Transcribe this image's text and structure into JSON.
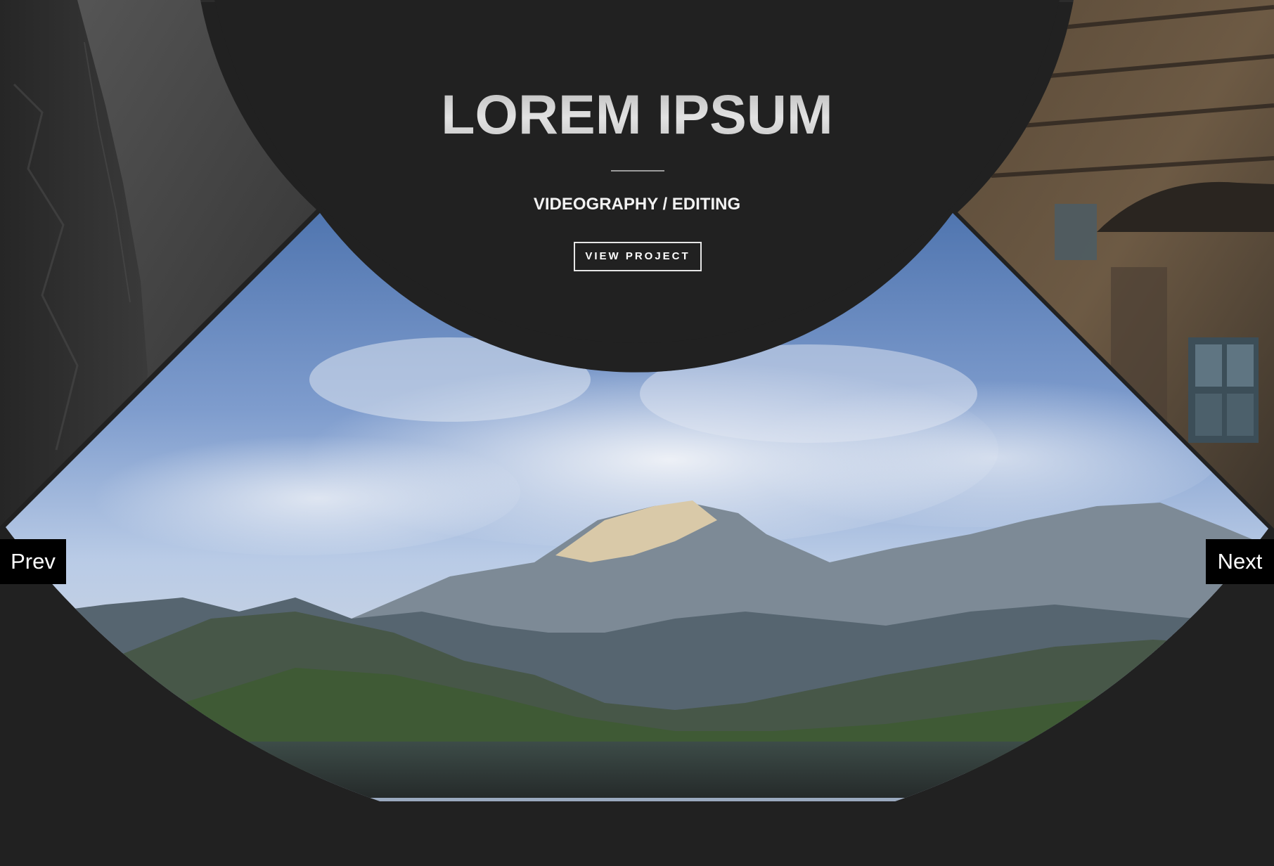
{
  "slide": {
    "title": "LOREM IPSUM",
    "subtitle": "VIDEOGRAPHY / EDITING",
    "button_label": "VIEW PROJECT"
  },
  "navigation": {
    "prev_label": "Prev",
    "next_label": "Next"
  },
  "colors": {
    "background": "#212121",
    "button_bg": "#000000",
    "text": "#ffffff"
  },
  "images": {
    "left_slide": "dark-rock-photo",
    "center_slide": "mountain-landscape-photo",
    "right_slide": "building-facade-photo"
  }
}
